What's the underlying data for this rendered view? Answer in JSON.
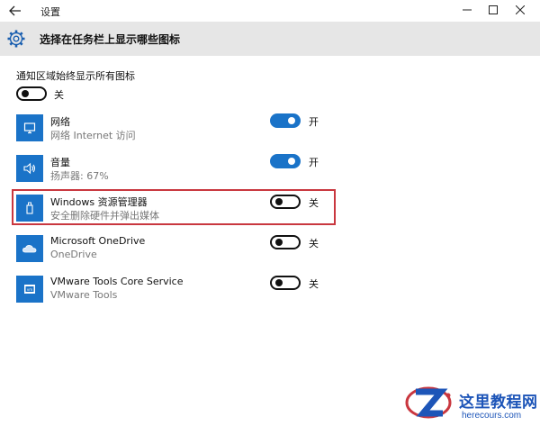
{
  "window": {
    "title": "设置",
    "back_icon": "back-arrow-icon",
    "minimize_icon": "minimize-icon",
    "maximize_icon": "maximize-icon",
    "close_icon": "close-icon"
  },
  "header": {
    "icon": "gear-icon",
    "title": "选择在任务栏上显示哪些图标"
  },
  "master_toggle": {
    "label": "通知区域始终显示所有图标",
    "state": "off",
    "state_text": "关"
  },
  "items": [
    {
      "name": "网络",
      "subtitle": "网络 Internet 访问",
      "icon": "monitor-icon",
      "state": "on",
      "state_text": "开"
    },
    {
      "name": "音量",
      "subtitle": "扬声器: 67%",
      "icon": "speaker-icon",
      "state": "on",
      "state_text": "开"
    },
    {
      "name": "Windows 资源管理器",
      "subtitle": "安全删除硬件并弹出媒体",
      "icon": "usb-drive-icon",
      "state": "off",
      "state_text": "关"
    },
    {
      "name": "Microsoft OneDrive",
      "subtitle": "OneDrive",
      "icon": "cloud-icon",
      "state": "off",
      "state_text": "关"
    },
    {
      "name": "VMware Tools Core Service",
      "subtitle": "VMware Tools",
      "icon": "vmware-icon",
      "state": "off",
      "state_text": "关"
    }
  ],
  "colors": {
    "accent": "#1a73c8",
    "header_bg": "#e6e6e6",
    "highlight_border": "#c9373f",
    "watermark": "#1d55b8"
  },
  "watermark": {
    "title": "这里教程网",
    "url": "herecours.com",
    "icon": "z-logo-icon"
  }
}
